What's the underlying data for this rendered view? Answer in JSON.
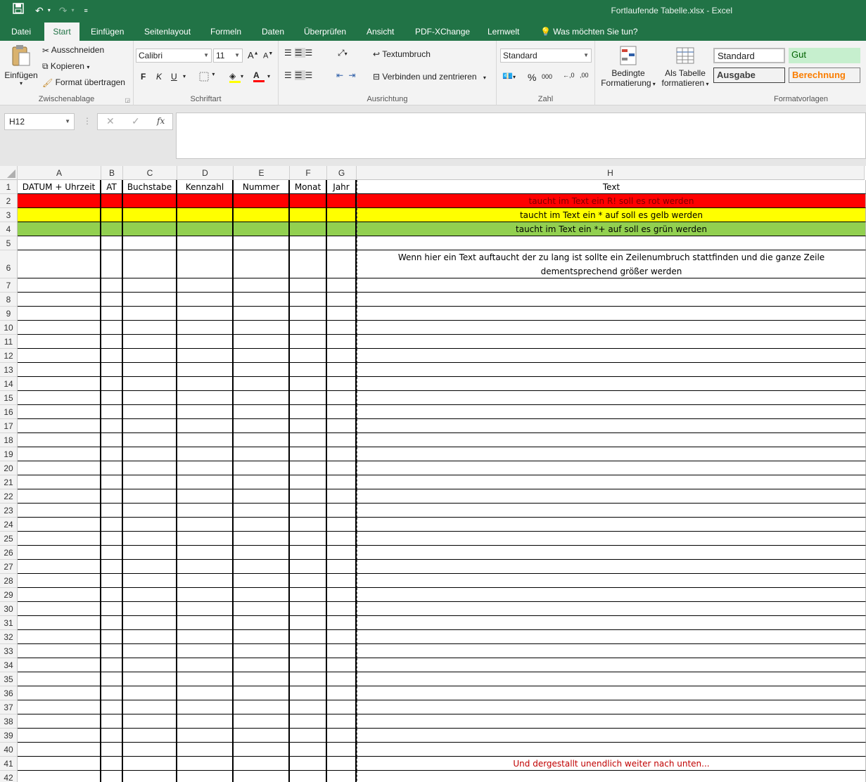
{
  "window": {
    "title": "Fortlaufende Tabelle.xlsx - Excel"
  },
  "qat": {
    "save_icon": "save-icon",
    "undo_icon": "undo-icon",
    "redo_icon": "redo-icon"
  },
  "tabs": [
    "Datei",
    "Start",
    "Einfügen",
    "Seitenlayout",
    "Formeln",
    "Daten",
    "Überprüfen",
    "Ansicht",
    "PDF-XChange",
    "Lernwelt"
  ],
  "tell_me": "Was möchten Sie tun?",
  "ribbon": {
    "clipboard": {
      "paste": "Einfügen",
      "cut": "Ausschneiden",
      "copy": "Kopieren",
      "format_painter": "Format übertragen",
      "label": "Zwischenablage"
    },
    "font": {
      "name": "Calibri",
      "size": "11",
      "bold": "F",
      "italic": "K",
      "underline": "U",
      "label": "Schriftart"
    },
    "alignment": {
      "wrap": "Textumbruch",
      "merge": "Verbinden und zentrieren",
      "label": "Ausrichtung"
    },
    "number": {
      "format": "Standard",
      "label": "Zahl"
    },
    "styles": {
      "conditional_1": "Bedingte",
      "conditional_2": "Formatierung",
      "table_1": "Als Tabelle",
      "table_2": "formatieren",
      "gallery": [
        "Standard",
        "Gut",
        "Ausgabe",
        "Berechnung"
      ],
      "label": "Formatvorlagen"
    }
  },
  "formula_bar": {
    "name_box": "H12",
    "fx": "fx",
    "formula": ""
  },
  "columns": [
    "A",
    "B",
    "C",
    "D",
    "E",
    "F",
    "G",
    "H"
  ],
  "header_row": [
    "DATUM + Uhrzeit",
    "AT",
    "Buchstabe",
    "Kennzahl",
    "Nummer",
    "Monat",
    "Jahr",
    "Text"
  ],
  "colored_rows": [
    {
      "row": "2",
      "text": "taucht im Text ein R! soll es rot werden",
      "color": "#ff0000"
    },
    {
      "row": "3",
      "text": "taucht im Text ein * auf soll es gelb werden",
      "color": "#ffff00"
    },
    {
      "row": "4",
      "text": "taucht im Text ein *+ auf soll es grün werden",
      "color": "#92d050"
    }
  ],
  "wrap_row": {
    "row": "6",
    "line1": "Wenn hier ein Text auftaucht der zu lang ist sollte ein Zeilenumbruch stattfinden und die ganze Zeile",
    "line2": "dementsprechend größer werden"
  },
  "last_row": {
    "row": "41",
    "text": "Und dergestallt unendlich weiter nach unten...",
    "color": "#c00000"
  },
  "row_numbers": [
    "1",
    "2",
    "3",
    "4",
    "5",
    "6",
    "7",
    "8",
    "9",
    "10",
    "11",
    "12",
    "13",
    "14",
    "15",
    "16",
    "17",
    "18",
    "19",
    "20",
    "21",
    "22",
    "23",
    "24",
    "25",
    "26",
    "27",
    "28",
    "29",
    "30",
    "31",
    "32",
    "33",
    "34",
    "35",
    "36",
    "37",
    "38",
    "39",
    "40",
    "41",
    "42"
  ]
}
